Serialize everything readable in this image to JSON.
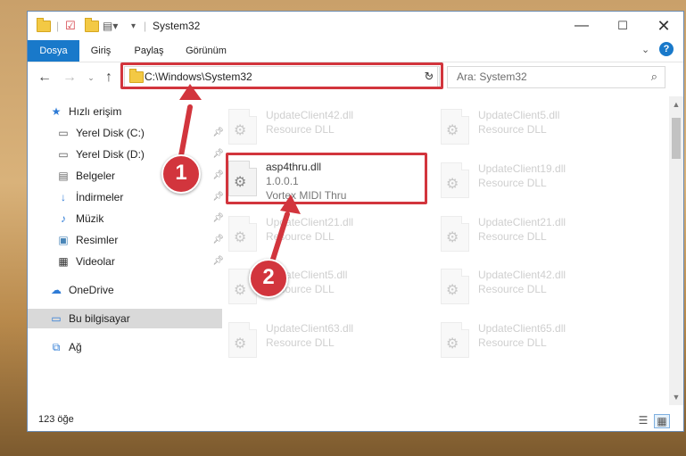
{
  "window": {
    "title": "System32"
  },
  "ribbon": {
    "tabs": [
      "Dosya",
      "Giriş",
      "Paylaş",
      "Görünüm"
    ]
  },
  "address": {
    "path": "C:\\Windows\\System32"
  },
  "search": {
    "placeholder": "Ara: System32"
  },
  "sidebar": {
    "items": [
      {
        "label": "Hızlı erişim",
        "icon": "star-icon"
      },
      {
        "label": "Yerel Disk (C:)",
        "icon": "drive-icon",
        "pinned": true
      },
      {
        "label": "Yerel Disk (D:)",
        "icon": "drive-icon",
        "pinned": true
      },
      {
        "label": "Belgeler",
        "icon": "document-icon",
        "pinned": true
      },
      {
        "label": "İndirmeler",
        "icon": "download-icon",
        "pinned": true
      },
      {
        "label": "Müzik",
        "icon": "music-icon",
        "pinned": true
      },
      {
        "label": "Resimler",
        "icon": "picture-icon",
        "pinned": true
      },
      {
        "label": "Videolar",
        "icon": "video-icon",
        "pinned": true
      },
      {
        "label": "OneDrive",
        "icon": "cloud-icon"
      },
      {
        "label": "Bu bilgisayar",
        "icon": "computer-icon"
      },
      {
        "label": "Ağ",
        "icon": "network-icon"
      }
    ]
  },
  "files": {
    "left": [
      {
        "name": "UpdateClient42.dll",
        "type": "Resource DLL"
      },
      {
        "name": "asp4thru.dll",
        "version": "1.0.0.1",
        "desc": "Vortex MIDI Thru"
      },
      {
        "name": "UpdateClient21.dll",
        "type": "Resource DLL"
      },
      {
        "name": "UpdateClient5.dll",
        "type": "Resource DLL"
      },
      {
        "name": "UpdateClient63.dll",
        "type": "Resource DLL"
      }
    ],
    "right": [
      {
        "name": "UpdateClient5.dll",
        "type": "Resource DLL"
      },
      {
        "name": "UpdateClient19.dll",
        "type": "Resource DLL"
      },
      {
        "name": "UpdateClient21.dll",
        "type": "Resource DLL"
      },
      {
        "name": "UpdateClient42.dll",
        "type": "Resource DLL"
      },
      {
        "name": "UpdateClient65.dll",
        "type": "Resource DLL"
      }
    ]
  },
  "status": {
    "count": "123 öğe"
  },
  "annotations": {
    "step1": "1",
    "step2": "2"
  },
  "colors": {
    "accent": "#1979ca",
    "highlight": "#d2353d"
  }
}
